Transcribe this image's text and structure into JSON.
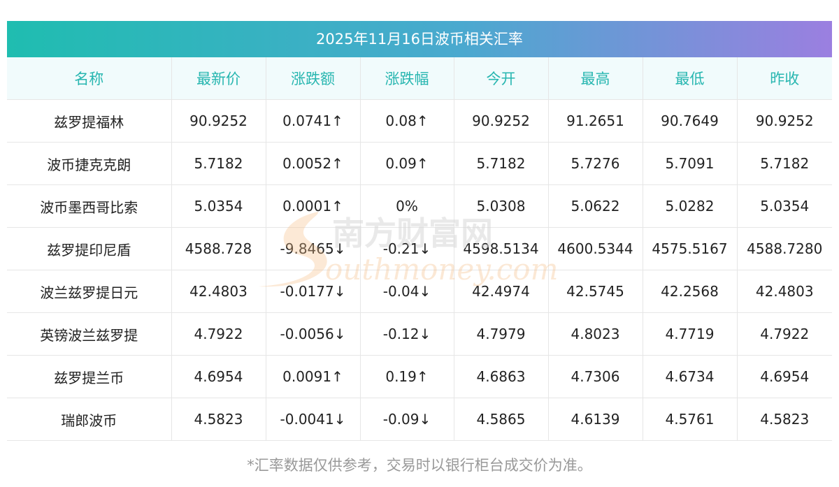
{
  "title": "2025年11月16日波币相关汇率",
  "columns": [
    "名称",
    "最新价",
    "涨跌额",
    "涨跌幅",
    "今开",
    "最高",
    "最低",
    "昨收"
  ],
  "rows": [
    {
      "name": "兹罗提福林",
      "last": "90.9252",
      "change": "0.0741↑",
      "pct": "0.08↑",
      "open": "90.9252",
      "high": "91.2651",
      "low": "90.7649",
      "prev": "90.9252",
      "dir": "up"
    },
    {
      "name": "波币捷克克朗",
      "last": "5.7182",
      "change": "0.0052↑",
      "pct": "0.09↑",
      "open": "5.7182",
      "high": "5.7276",
      "low": "5.7091",
      "prev": "5.7182",
      "dir": "up"
    },
    {
      "name": "波币墨西哥比索",
      "last": "5.0354",
      "change": "0.0001↑",
      "pct": "0%",
      "open": "5.0308",
      "high": "5.0622",
      "low": "5.0282",
      "prev": "5.0354",
      "dir": "flat"
    },
    {
      "name": "兹罗提印尼盾",
      "last": "4588.728",
      "change": "-9.8465↓",
      "pct": "-0.21↓",
      "open": "4598.5134",
      "high": "4600.5344",
      "low": "4575.5167",
      "prev": "4588.7280",
      "dir": "down"
    },
    {
      "name": "波兰兹罗提日元",
      "last": "42.4803",
      "change": "-0.0177↓",
      "pct": "-0.04↓",
      "open": "42.4974",
      "high": "42.5745",
      "low": "42.2568",
      "prev": "42.4803",
      "dir": "down"
    },
    {
      "name": "英镑波兰兹罗提",
      "last": "4.7922",
      "change": "-0.0056↓",
      "pct": "-0.12↓",
      "open": "4.7979",
      "high": "4.8023",
      "low": "4.7719",
      "prev": "4.7922",
      "dir": "down"
    },
    {
      "name": "兹罗提兰币",
      "last": "4.6954",
      "change": "0.0091↑",
      "pct": "0.19↑",
      "open": "4.6863",
      "high": "4.7306",
      "low": "4.6734",
      "prev": "4.6954",
      "dir": "up"
    },
    {
      "name": "瑞郎波币",
      "last": "4.5823",
      "change": "-0.0041↓",
      "pct": "-0.09↓",
      "open": "4.5865",
      "high": "4.6139",
      "low": "4.5761",
      "prev": "4.5823",
      "dir": "down"
    }
  ],
  "watermark": {
    "cn": "南方财富网",
    "en": "outhmoney.com"
  },
  "footnote": "*汇率数据仅供参考，交易时以银行柜台成交价为准。",
  "colors": {
    "up": "#ee1f1f",
    "down": "#1f8a1f",
    "header_text": "#27b6b0",
    "banner_start": "#1fbdb0",
    "banner_end": "#9b7fe0"
  }
}
